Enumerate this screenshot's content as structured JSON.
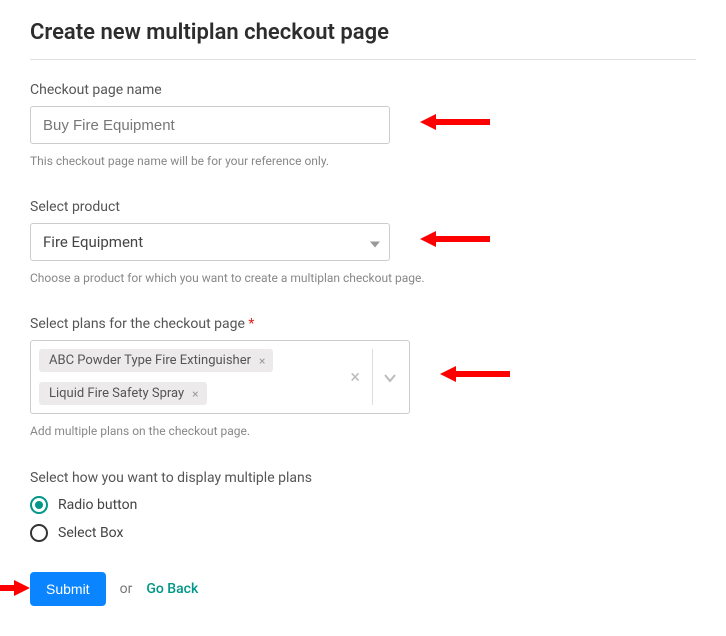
{
  "title": "Create new multiplan checkout page",
  "fields": {
    "name": {
      "label": "Checkout page name",
      "value": "Buy Fire Equipment",
      "helper": "This checkout page name will be for your reference only."
    },
    "product": {
      "label": "Select product",
      "value": "Fire Equipment",
      "helper": "Choose a product for which you want to create a multiplan checkout page."
    },
    "plans": {
      "label": "Select plans for the checkout page",
      "tags": [
        "ABC Powder Type Fire Extinguisher",
        "Liquid Fire Safety Spray"
      ],
      "helper": "Add multiple plans on the checkout page."
    },
    "display": {
      "label": "Select how you want to display multiple plans",
      "options": [
        "Radio button",
        "Select Box"
      ],
      "selected": "Radio button"
    }
  },
  "actions": {
    "submit": "Submit",
    "or": "or",
    "back": "Go Back"
  }
}
